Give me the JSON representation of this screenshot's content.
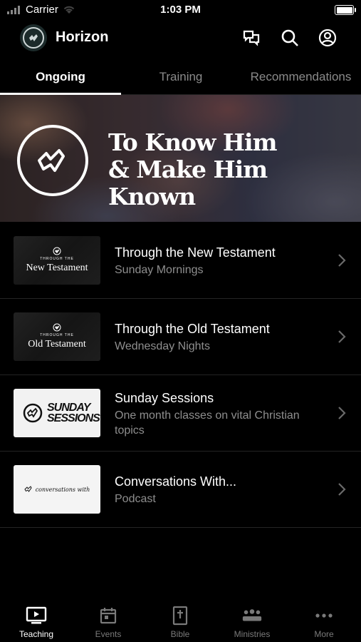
{
  "status_bar": {
    "carrier": "Carrier",
    "time": "1:03 PM",
    "battery_level": 1.0
  },
  "header": {
    "app_title": "Horizon",
    "icons": [
      "church-logo-icon",
      "chat-icon",
      "search-icon",
      "account-icon"
    ]
  },
  "tabs": [
    {
      "label": "Ongoing",
      "active": true
    },
    {
      "label": "Training",
      "active": false
    },
    {
      "label": "Recommendations",
      "active": false
    }
  ],
  "banner": {
    "line1": "To Know Him",
    "line2": "& Make Him Known"
  },
  "items": [
    {
      "title": "Through the New Testament",
      "subtitle": "Sunday Mornings",
      "thumb_small": "THROUGH THE",
      "thumb_main": "New Testament"
    },
    {
      "title": "Through the Old Testament",
      "subtitle": "Wednesday Nights",
      "thumb_small": "THROUGH THE",
      "thumb_main": "Old Testament"
    },
    {
      "title": "Sunday Sessions",
      "subtitle": "One month classes on vital Christian topics",
      "thumb_main": "SUNDAY SESSIONS"
    },
    {
      "title": "Conversations With...",
      "subtitle": "Podcast",
      "thumb_main": "conversations with"
    }
  ],
  "tabbar": [
    {
      "label": "Teaching",
      "icon": "tv-play-icon",
      "active": true
    },
    {
      "label": "Events",
      "icon": "calendar-icon",
      "active": false
    },
    {
      "label": "Bible",
      "icon": "bible-icon",
      "active": false
    },
    {
      "label": "Ministries",
      "icon": "people-icon",
      "active": false
    },
    {
      "label": "More",
      "icon": "more-dots-icon",
      "active": false
    }
  ]
}
